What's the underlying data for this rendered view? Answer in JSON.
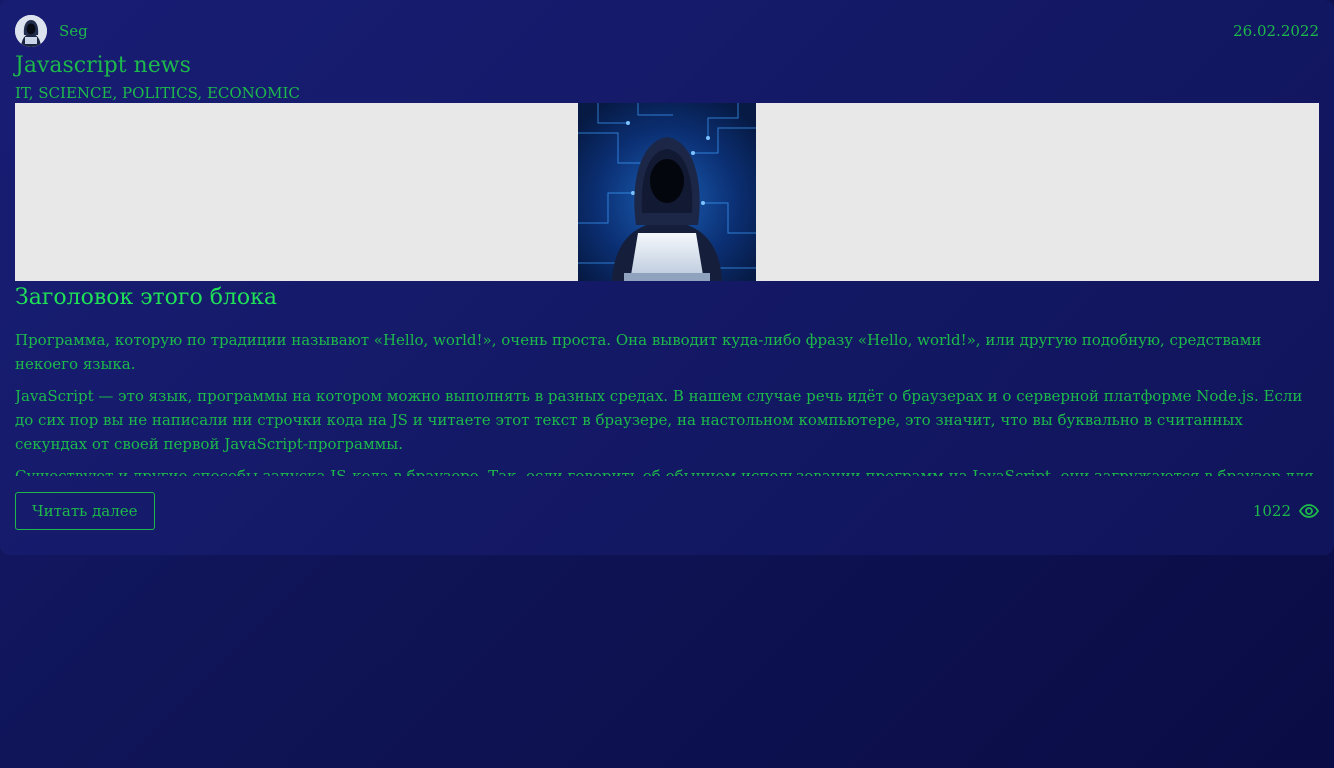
{
  "post": {
    "author": "Seg",
    "date": "26.02.2022",
    "title": "Javascript news",
    "tags": "IT, SCIENCE, POLITICS, ECONOMIC",
    "block_heading": "Заголовок этого блока",
    "paragraphs": [
      "Программа, которую по традиции называют «Hello, world!», очень проста. Она выводит куда-либо фразу «Hello, world!», или другую подобную, средствами некоего языка.",
      "JavaScript — это язык, программы на котором можно выполнять в разных средах. В нашем случае речь идёт о браузерах и о серверной платформе Node.js. Если до сих пор вы не написали ни строчки кода на JS и читаете этот текст в браузере, на настольном компьютере, это значит, что вы буквально в считанных секундах от своей первой JavaScript-программы.",
      "Существуют и другие способы запуска JS-кода в браузере. Так, если говорить об обычном использовании программ на JavaScript, они загружаются в браузер для обеспечения работы веб-страниц. Как правило, код оформляют в виде отдельных файлов с расширением .js, которые подключают к веб-страницам, но программный код можно включать и непосредственно в код страницы. Всё это делается с помощью тега <script>. Когда браузер обнаруживает такой код, он выполняет его. Подробности о теге script можно посмотреть на сайте w3school.com. В"
    ],
    "read_more_label": "Читать далее",
    "views": "1022",
    "icons": {
      "avatar": "hooded-hacker-avatar",
      "views": "eye-icon"
    },
    "colors": {
      "accent": "#1db94a",
      "heading": "#1fe057",
      "background": "#141966"
    }
  }
}
